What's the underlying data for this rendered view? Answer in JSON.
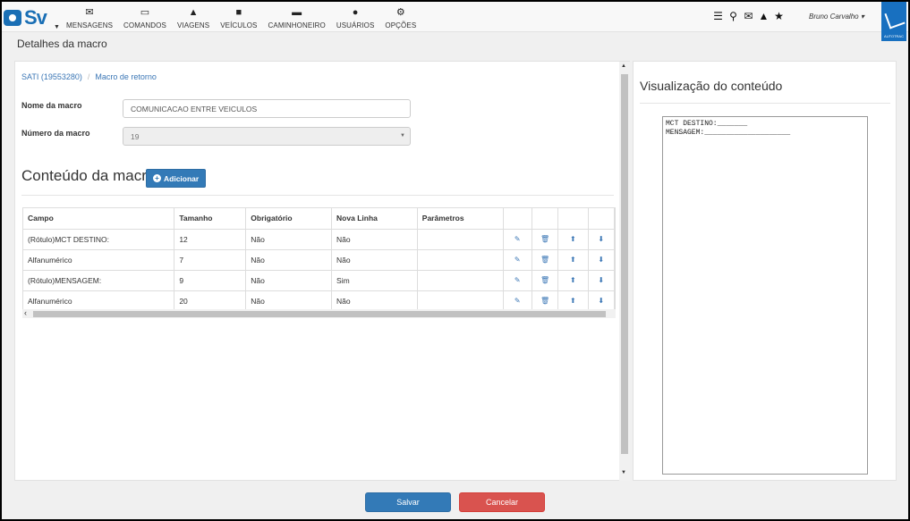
{
  "nav": {
    "items": [
      {
        "label": "MENSAGENS",
        "icon": "envelope-icon",
        "glyph": "✉"
      },
      {
        "label": "COMANDOS",
        "icon": "laptop-icon",
        "glyph": "▭"
      },
      {
        "label": "VIAGENS",
        "icon": "road-icon",
        "glyph": "⏶"
      },
      {
        "label": "VEÍCULOS",
        "icon": "car-icon",
        "glyph": "⛟"
      },
      {
        "label": "CAMINHONEIRO",
        "icon": "truck-icon",
        "glyph": "⛟"
      },
      {
        "label": "USUÁRIOS",
        "icon": "user-icon",
        "glyph": "●"
      },
      {
        "label": "OPÇÕES",
        "icon": "cogs-icon",
        "glyph": "⚙"
      }
    ],
    "logo": "Sv",
    "user_name": "Bruno Carvalho",
    "brand_text": "AUTOTRAC"
  },
  "page_title": "Detalhes da macro",
  "breadcrumb": {
    "first": "SATI (19553280)",
    "second": "Macro de retorno"
  },
  "form": {
    "name_label": "Nome da macro",
    "name_value": "COMUNICACAO ENTRE VEICULOS",
    "number_label": "Número da macro",
    "number_value": "19"
  },
  "content": {
    "title": "Conteúdo da macro",
    "add_label": "Adicionar"
  },
  "table": {
    "headers": [
      "Campo",
      "Tamanho",
      "Obrigatório",
      "Nova Linha",
      "Parâmetros"
    ],
    "rows": [
      [
        "(Rótulo)MCT DESTINO:",
        "12",
        "Não",
        "Não",
        ""
      ],
      [
        "Alfanumérico",
        "7",
        "Não",
        "Não",
        ""
      ],
      [
        "(Rótulo)MENSAGEM:",
        "9",
        "Não",
        "Sim",
        ""
      ],
      [
        "Alfanumérico",
        "20",
        "Não",
        "Não",
        ""
      ]
    ]
  },
  "preview": {
    "title": "Visualização do conteúdo",
    "text": "MCT DESTINO:_______\nMENSAGEM:____________________"
  },
  "buttons": {
    "save": "Salvar",
    "cancel": "Cancelar"
  }
}
